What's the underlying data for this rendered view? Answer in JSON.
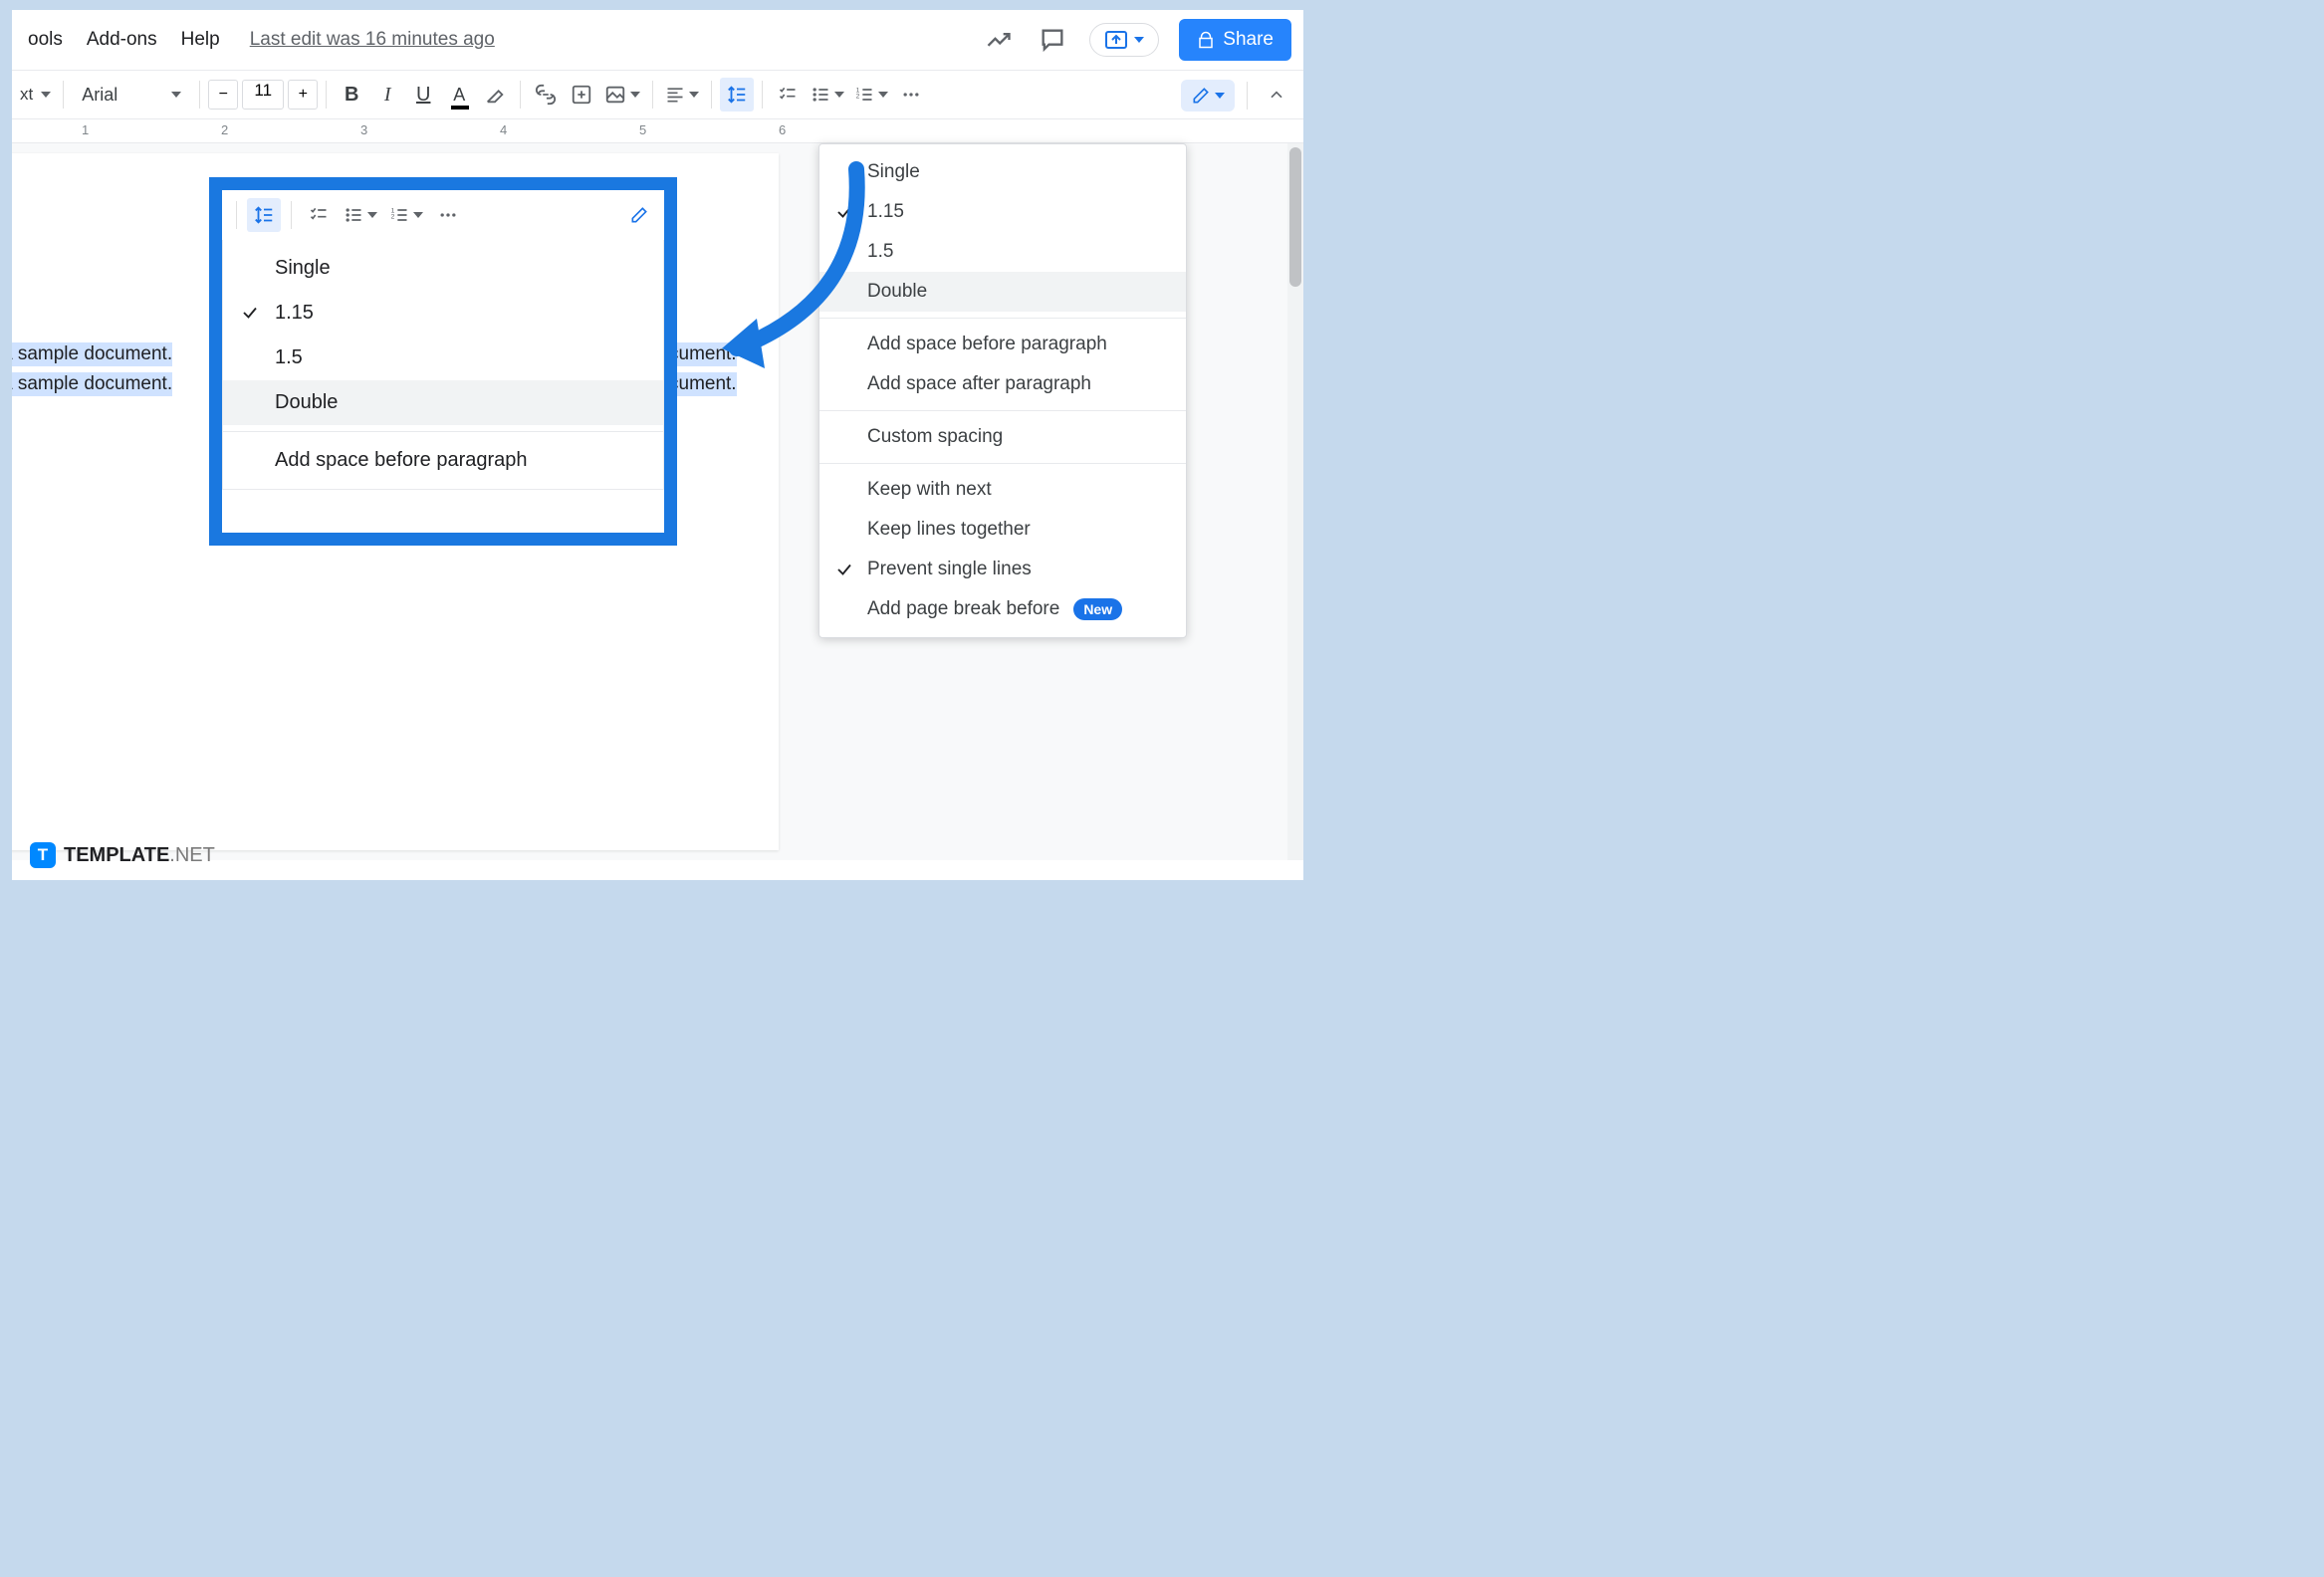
{
  "menubar": {
    "items": [
      "ools",
      "Add-ons",
      "Help"
    ],
    "last_edit": "Last edit was 16 minutes ago"
  },
  "topright": {
    "share_label": "Share"
  },
  "toolbar": {
    "text_style_label": "xt",
    "font_name": "Arial",
    "font_size": "11"
  },
  "ruler": {
    "marks": [
      "1",
      "2",
      "3",
      "4",
      "5",
      "6"
    ]
  },
  "document": {
    "line1_left": "a sample document.",
    "line2_left": "a sample document.",
    "line1_right": "cument.",
    "line2_right": "cument."
  },
  "spacing_menu": {
    "opts": [
      "Single",
      "1.15",
      "1.5",
      "Double",
      "Add space before paragraph",
      "Add space after paragraph",
      "Custom spacing",
      "Keep with next",
      "Keep lines together",
      "Prevent single lines",
      "Add page break before"
    ],
    "new_badge": "New"
  },
  "highlight_menu": {
    "opts": [
      "Single",
      "1.15",
      "1.5",
      "Double",
      "Add space before paragraph"
    ]
  },
  "watermark": {
    "bold": "TEMPLATE",
    "light": ".NET"
  }
}
